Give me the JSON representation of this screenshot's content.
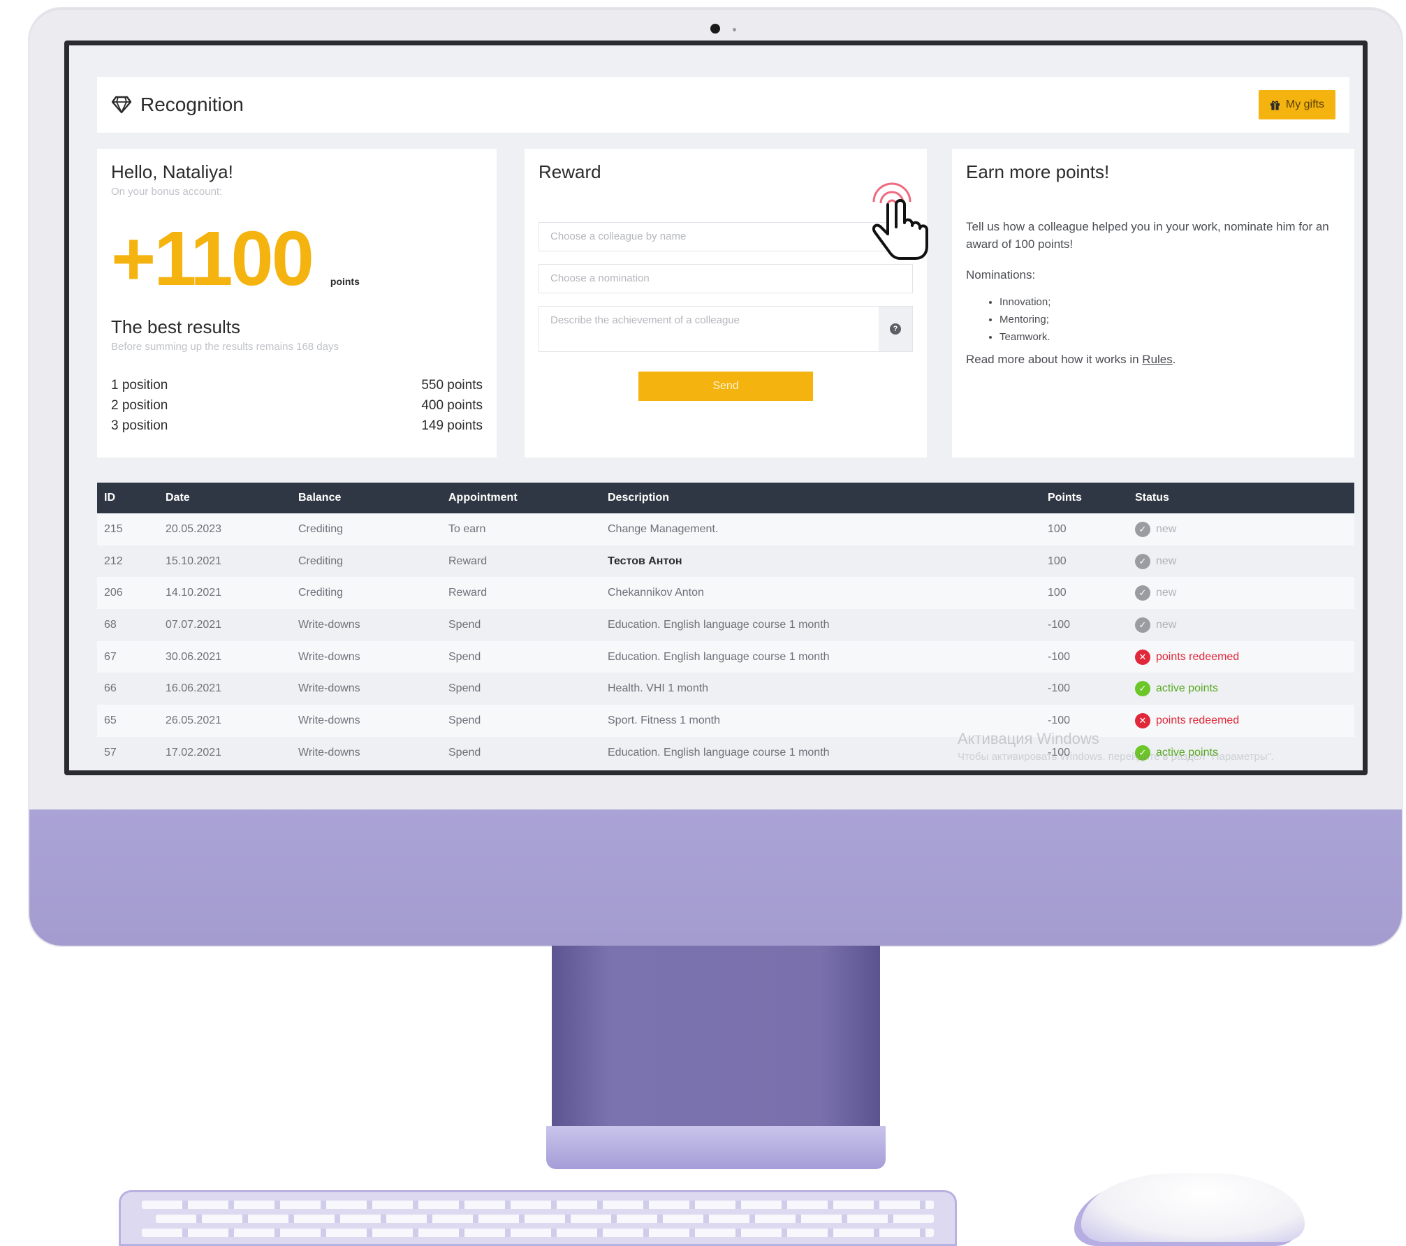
{
  "app": {
    "title": "Recognition",
    "gifts_button": "My gifts"
  },
  "hello": {
    "greeting": "Hello, Nataliya!",
    "subtitle": "On your bonus account:",
    "points_value": "+1100",
    "points_unit": "points",
    "best_title": "The best results",
    "best_subtitle": "Before summing up the results remains 168 days",
    "ranks": [
      {
        "position": "1 position",
        "points": "550 points"
      },
      {
        "position": "2 position",
        "points": "400 points"
      },
      {
        "position": "3 position",
        "points": "149 points"
      }
    ]
  },
  "reward": {
    "title": "Reward",
    "colleague_placeholder": "Choose a colleague by name",
    "nomination_placeholder": "Choose a nomination",
    "description_placeholder": "Describe the achievement of a colleague",
    "send_label": "Send"
  },
  "earn": {
    "title": "Earn more points!",
    "text": "Tell us how a colleague helped you in your work, nominate him for an award of 100 points!",
    "nominations_label": "Nominations:",
    "nominations": [
      "Innovation;",
      "Mentoring;",
      "Teamwork."
    ],
    "more_text": "Read more about how it works in",
    "rules_link": "Rules",
    "more_suffix": "."
  },
  "table": {
    "headers": [
      "ID",
      "Date",
      "Balance",
      "Appointment",
      "Description",
      "Points",
      "Status"
    ],
    "rows": [
      {
        "id": "215",
        "date": "20.05.2023",
        "balance": "Crediting",
        "appointment": "To earn",
        "description": "Change Management.",
        "points": "100",
        "status": "new",
        "status_type": "new"
      },
      {
        "id": "212",
        "date": "15.10.2021",
        "balance": "Crediting",
        "appointment": "Reward",
        "description": "Тестов Антон",
        "points": "100",
        "status": "new",
        "status_type": "new",
        "bold": true
      },
      {
        "id": "206",
        "date": "14.10.2021",
        "balance": "Crediting",
        "appointment": "Reward",
        "description": "Chekannikov Anton",
        "points": "100",
        "status": "new",
        "status_type": "new"
      },
      {
        "id": "68",
        "date": "07.07.2021",
        "balance": "Write-downs",
        "appointment": "Spend",
        "description": "Education. English language course 1 month",
        "points": "-100",
        "status": "new",
        "status_type": "new"
      },
      {
        "id": "67",
        "date": "30.06.2021",
        "balance": "Write-downs",
        "appointment": "Spend",
        "description": "Education. English language course 1 month",
        "points": "-100",
        "status": "points redeemed",
        "status_type": "redeemed"
      },
      {
        "id": "66",
        "date": "16.06.2021",
        "balance": "Write-downs",
        "appointment": "Spend",
        "description": "Health. VHI 1 month",
        "points": "-100",
        "status": "active points",
        "status_type": "active"
      },
      {
        "id": "65",
        "date": "26.05.2021",
        "balance": "Write-downs",
        "appointment": "Spend",
        "description": "Sport. Fitness 1 month",
        "points": "-100",
        "status": "points redeemed",
        "status_type": "redeemed"
      },
      {
        "id": "57",
        "date": "17.02.2021",
        "balance": "Write-downs",
        "appointment": "Spend",
        "description": "Education. English language course 1 month",
        "points": "-100",
        "status": "active points",
        "status_type": "active"
      }
    ]
  },
  "watermark": {
    "title": "Активация Windows",
    "subtitle": "Чтобы активировать Windows, перейдите в раздел \"Параметры\"."
  },
  "colors": {
    "accent": "#f5b30f",
    "table_header": "#303744",
    "redeemed": "#e0283a",
    "active": "#6cc628",
    "monitor_chin": "#a8a1d4"
  }
}
